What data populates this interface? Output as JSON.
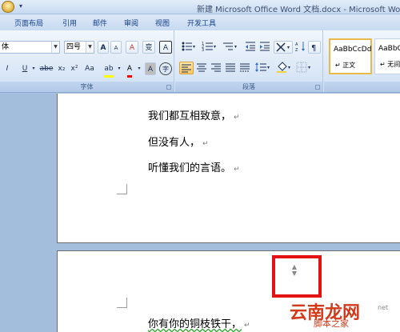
{
  "window": {
    "title": "新建 Microsoft Office Word 文档.docx - Microsoft Word"
  },
  "tabs": [
    {
      "label": "页面布局"
    },
    {
      "label": "引用"
    },
    {
      "label": "邮件"
    },
    {
      "label": "审阅"
    },
    {
      "label": "视图"
    },
    {
      "label": "开发工具"
    }
  ],
  "font_group": {
    "label": "字体",
    "font_name": "体",
    "font_size": "四号",
    "grow_font": "A",
    "shrink_font": "A",
    "clear_format": "A",
    "phonetic": "变",
    "char_border": "A",
    "italic": "I",
    "underline": "U",
    "strikethrough": "abe",
    "subscript": "x₂",
    "superscript": "x²",
    "change_case": "Aa",
    "highlight": "ab",
    "font_color": "A",
    "char_shading": "A",
    "enclose_char": "字"
  },
  "paragraph_group": {
    "label": "段落"
  },
  "styles_group": {
    "cards": [
      {
        "sample": "AaBbCcDd",
        "name": "正文"
      },
      {
        "sample": "AaBbCc",
        "name": "无间"
      }
    ]
  },
  "document": {
    "page1_lines": [
      {
        "text": "我们都互相致意，"
      },
      {
        "text": "但没有人，"
      },
      {
        "text": "听懂我们的言语。"
      }
    ],
    "page2_lines": [
      {
        "text": "你有你的铜枝铁干，"
      }
    ],
    "paragraph_mark": "↵"
  },
  "watermark": {
    "text": "云南龙网",
    "sub": "脚本之家",
    "url": "net"
  },
  "colors": {
    "highlight": "#ffff00",
    "font_color": "#ff0000",
    "red_box": "#e41212"
  }
}
